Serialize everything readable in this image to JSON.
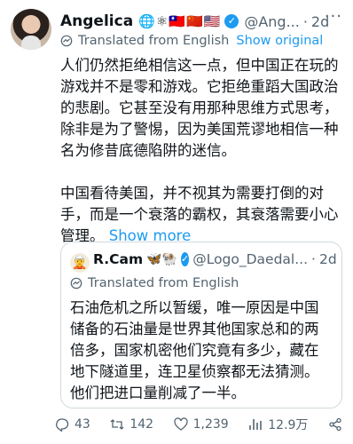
{
  "author": {
    "name": "Angelica",
    "emojis": "🌐⚛🇹🇼🇨🇳🇺🇸",
    "handle": "@Ang...",
    "time": "2d"
  },
  "translation": {
    "label": "Translated from English",
    "show_original": "Show original"
  },
  "body": {
    "para1": "人们仍然拒绝相信这一点，但中国正在玩的游戏并不是零和游戏。它拒绝重蹈大国政治的悲剧。它甚至没有用那种思维方式思考，除非是为了警惕，因为美国荒谬地相信一种名为修昔底德陷阱的迷信。",
    "para2": "中国看待美国，并不视其为需要打倒的对手，而是一个衰落的霸权，其衰落需要小心管理。",
    "show_more": "Show more"
  },
  "quote": {
    "name": "R.Cam",
    "emojis": "🦋🐏",
    "handle": "@Logo_Daedal...",
    "time": "2d",
    "translated": "Translated from English",
    "text": "石油危机之所以暂缓，唯一原因是中国储备的石油量是世界其他国家总和的两倍多，国家机密他们究竟有多少，藏在地下隧道里，连卫星侦察都无法猜测。他们把进口量削减了一半。"
  },
  "actions": {
    "replies": "43",
    "reposts": "142",
    "likes": "1,239",
    "views": "12.9万"
  },
  "dot": "·",
  "more_menu": "···"
}
